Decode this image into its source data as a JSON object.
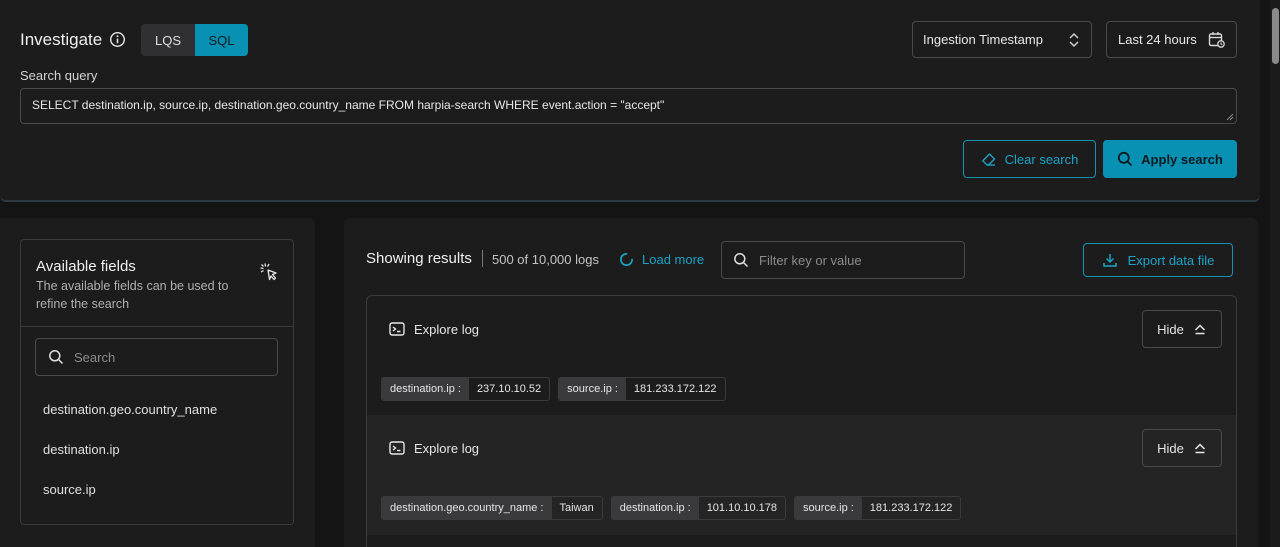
{
  "header": {
    "title": "Investigate",
    "modes": [
      "LQS",
      "SQL"
    ],
    "active_mode": "SQL",
    "timestamp_field": "Ingestion Timestamp",
    "time_range": "Last 24 hours"
  },
  "query": {
    "label": "Search query",
    "value": "SELECT destination.ip, source.ip,  destination.geo.country_name FROM harpia-search  WHERE event.action = \"accept\"",
    "clear_label": "Clear search",
    "apply_label": "Apply search"
  },
  "fields_panel": {
    "title": "Available fields",
    "description": "The available fields can be used to refine the search",
    "search_placeholder": "Search",
    "items": [
      "destination.geo.country_name",
      "destination.ip",
      "source.ip"
    ]
  },
  "results": {
    "heading": "Showing results",
    "count": "500 of 10,000 logs",
    "load_more": "Load more",
    "filter_placeholder": "Filter key or value",
    "export_label": "Export data file",
    "rows": [
      {
        "explore_label": "Explore log",
        "hide_label": "Hide",
        "fields": [
          {
            "key": "destination.ip :",
            "value": "237.10.10.52"
          },
          {
            "key": "source.ip :",
            "value": "181.233.172.122"
          }
        ]
      },
      {
        "explore_label": "Explore log",
        "hide_label": "Hide",
        "fields": [
          {
            "key": "destination.geo.country_name :",
            "value": "Taiwan"
          },
          {
            "key": "destination.ip :",
            "value": "101.10.10.178"
          },
          {
            "key": "source.ip :",
            "value": "181.233.172.122"
          }
        ]
      }
    ]
  },
  "colors": {
    "accent": "#0891b2",
    "link": "#1ba3c6",
    "background": "#141414",
    "panel": "#1c1c1d"
  }
}
